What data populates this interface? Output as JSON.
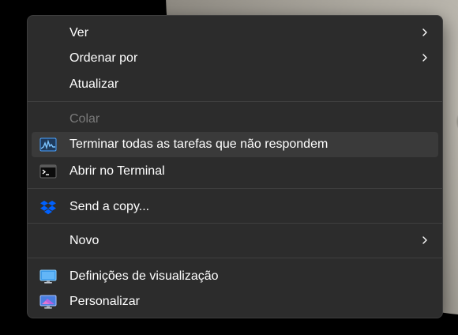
{
  "menu": {
    "items": {
      "ver": "Ver",
      "ordenar": "Ordenar por",
      "atualizar": "Atualizar",
      "colar": "Colar",
      "terminar": "Terminar todas as tarefas que não respondem",
      "abrir_terminal": "Abrir no Terminal",
      "send_copy": "Send a copy...",
      "novo": "Novo",
      "definicoes": "Definições de visualização",
      "personalizar": "Personalizar"
    },
    "icons": {
      "terminar": "task-manager-icon",
      "abrir_terminal": "terminal-icon",
      "send_copy": "dropbox-icon",
      "definicoes": "display-settings-icon",
      "personalizar": "personalize-icon"
    },
    "colors": {
      "background": "#2c2c2c",
      "hover": "#3a3a3a",
      "text": "#ffffff",
      "disabled_text": "#7a7a7a",
      "dropbox_blue": "#0061fe"
    }
  }
}
